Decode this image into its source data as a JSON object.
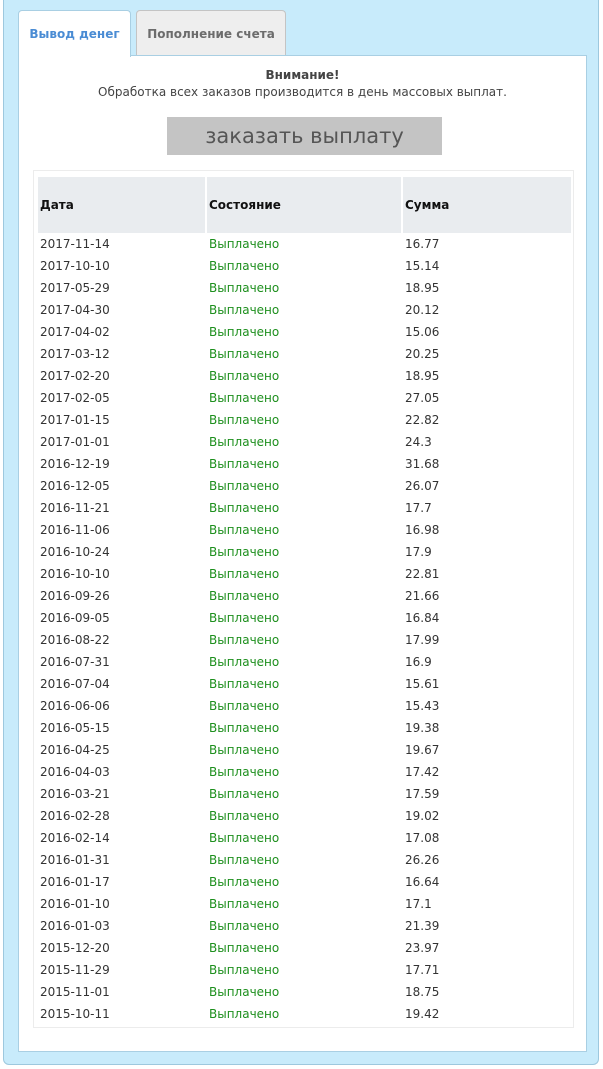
{
  "tabs": {
    "withdraw": "Вывод денег",
    "deposit": "Пополнение счета"
  },
  "notice": {
    "title": "Внимание!",
    "text": "Обработка всех заказов производится в день массовых выплат."
  },
  "order_button": "заказать выплату",
  "table": {
    "headers": {
      "date": "Дата",
      "status": "Состояние",
      "sum": "Сумма"
    },
    "rows": [
      {
        "date": "2017-11-14",
        "status": "Выплачено",
        "sum": "16.77"
      },
      {
        "date": "2017-10-10",
        "status": "Выплачено",
        "sum": "15.14"
      },
      {
        "date": "2017-05-29",
        "status": "Выплачено",
        "sum": "18.95"
      },
      {
        "date": "2017-04-30",
        "status": "Выплачено",
        "sum": "20.12"
      },
      {
        "date": "2017-04-02",
        "status": "Выплачено",
        "sum": "15.06"
      },
      {
        "date": "2017-03-12",
        "status": "Выплачено",
        "sum": "20.25"
      },
      {
        "date": "2017-02-20",
        "status": "Выплачено",
        "sum": "18.95"
      },
      {
        "date": "2017-02-05",
        "status": "Выплачено",
        "sum": "27.05"
      },
      {
        "date": "2017-01-15",
        "status": "Выплачено",
        "sum": "22.82"
      },
      {
        "date": "2017-01-01",
        "status": "Выплачено",
        "sum": "24.3"
      },
      {
        "date": "2016-12-19",
        "status": "Выплачено",
        "sum": "31.68"
      },
      {
        "date": "2016-12-05",
        "status": "Выплачено",
        "sum": "26.07"
      },
      {
        "date": "2016-11-21",
        "status": "Выплачено",
        "sum": "17.7"
      },
      {
        "date": "2016-11-06",
        "status": "Выплачено",
        "sum": "16.98"
      },
      {
        "date": "2016-10-24",
        "status": "Выплачено",
        "sum": "17.9"
      },
      {
        "date": "2016-10-10",
        "status": "Выплачено",
        "sum": "22.81"
      },
      {
        "date": "2016-09-26",
        "status": "Выплачено",
        "sum": "21.66"
      },
      {
        "date": "2016-09-05",
        "status": "Выплачено",
        "sum": "16.84"
      },
      {
        "date": "2016-08-22",
        "status": "Выплачено",
        "sum": "17.99"
      },
      {
        "date": "2016-07-31",
        "status": "Выплачено",
        "sum": "16.9"
      },
      {
        "date": "2016-07-04",
        "status": "Выплачено",
        "sum": "15.61"
      },
      {
        "date": "2016-06-06",
        "status": "Выплачено",
        "sum": "15.43"
      },
      {
        "date": "2016-05-15",
        "status": "Выплачено",
        "sum": "19.38"
      },
      {
        "date": "2016-04-25",
        "status": "Выплачено",
        "sum": "19.67"
      },
      {
        "date": "2016-04-03",
        "status": "Выплачено",
        "sum": "17.42"
      },
      {
        "date": "2016-03-21",
        "status": "Выплачено",
        "sum": "17.59"
      },
      {
        "date": "2016-02-28",
        "status": "Выплачено",
        "sum": "19.02"
      },
      {
        "date": "2016-02-14",
        "status": "Выплачено",
        "sum": "17.08"
      },
      {
        "date": "2016-01-31",
        "status": "Выплачено",
        "sum": "26.26"
      },
      {
        "date": "2016-01-17",
        "status": "Выплачено",
        "sum": "16.64"
      },
      {
        "date": "2016-01-10",
        "status": "Выплачено",
        "sum": "17.1"
      },
      {
        "date": "2016-01-03",
        "status": "Выплачено",
        "sum": "21.39"
      },
      {
        "date": "2015-12-20",
        "status": "Выплачено",
        "sum": "23.97"
      },
      {
        "date": "2015-11-29",
        "status": "Выплачено",
        "sum": "17.71"
      },
      {
        "date": "2015-11-01",
        "status": "Выплачено",
        "sum": "18.75"
      },
      {
        "date": "2015-10-11",
        "status": "Выплачено",
        "sum": "19.42"
      }
    ]
  },
  "colors": {
    "frame_background": "#c8ebfb",
    "active_tab_text": "#4a8cd4",
    "status_paid": "#1d8f1d",
    "button_background": "#c4c4c4"
  }
}
